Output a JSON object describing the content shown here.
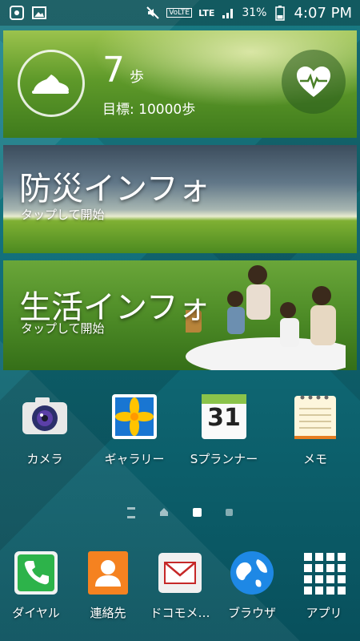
{
  "status_bar": {
    "time": "4:07 PM",
    "battery": "31%",
    "network": "LTE",
    "volte": "VoLTE",
    "icons": [
      "notification-icon",
      "gallery-notification-icon",
      "mute-icon",
      "volte-icon",
      "lte-icon",
      "signal-icon",
      "battery-icon"
    ]
  },
  "widgets": {
    "pedometer": {
      "steps": "7",
      "steps_unit": "歩",
      "goal": "目標: 10000歩"
    },
    "disaster": {
      "title": "防災インフォ",
      "subtitle": "タップして開始"
    },
    "life": {
      "title": "生活インフォ",
      "subtitle": "タップして開始"
    }
  },
  "home_apps": [
    {
      "label": "カメラ",
      "icon": "camera-icon"
    },
    {
      "label": "ギャラリー",
      "icon": "gallery-icon"
    },
    {
      "label": "Sプランナー",
      "icon": "calendar-icon",
      "date": "31"
    },
    {
      "label": "メモ",
      "icon": "memo-icon"
    }
  ],
  "pager": {
    "pages": 4,
    "active": 2
  },
  "dock": [
    {
      "label": "ダイヤル",
      "icon": "phone-icon"
    },
    {
      "label": "連絡先",
      "icon": "contacts-icon"
    },
    {
      "label": "ドコモメ…",
      "icon": "mail-icon"
    },
    {
      "label": "ブラウザ",
      "icon": "globe-icon"
    },
    {
      "label": "アプリ",
      "icon": "apps-grid-icon"
    }
  ],
  "colors": {
    "accent_green": "#8bc34a",
    "dock_phone": "#2db34a",
    "dock_contacts": "#f58220"
  }
}
